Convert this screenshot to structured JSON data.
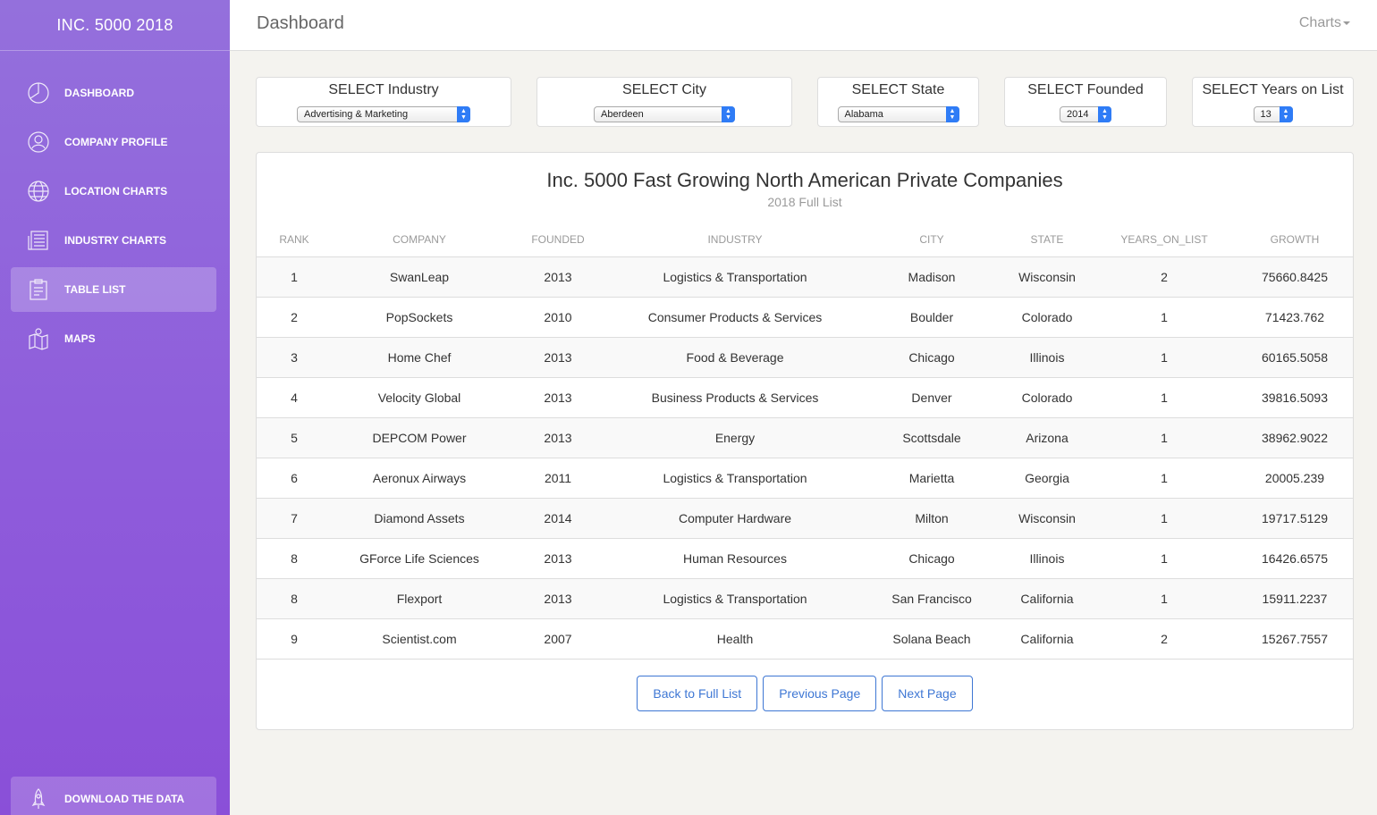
{
  "app": {
    "brand": "INC. 5000 2018"
  },
  "header": {
    "title": "Dashboard",
    "menu": "Charts"
  },
  "sidebar": {
    "items": [
      {
        "label": "DASHBOARD",
        "icon": "pie-chart-icon",
        "active": false
      },
      {
        "label": "COMPANY PROFILE",
        "icon": "user-icon",
        "active": false
      },
      {
        "label": "LOCATION CHARTS",
        "icon": "globe-icon",
        "active": false
      },
      {
        "label": "INDUSTRY CHARTS",
        "icon": "news-icon",
        "active": false
      },
      {
        "label": "TABLE LIST",
        "icon": "clipboard-icon",
        "active": true
      },
      {
        "label": "MAPS",
        "icon": "map-icon",
        "active": false
      }
    ],
    "download": {
      "label": "DOWNLOAD THE DATA",
      "icon": "rocket-icon"
    }
  },
  "filters": [
    {
      "label": "SELECT Industry",
      "value": "Advertising & Marketing"
    },
    {
      "label": "SELECT City",
      "value": "Aberdeen"
    },
    {
      "label": "SELECT State",
      "value": "Alabama"
    },
    {
      "label": "SELECT Founded",
      "value": "2014"
    },
    {
      "label": "SELECT Years on List",
      "value": "13"
    }
  ],
  "table": {
    "title": "Inc. 5000 Fast Growing North American Private Companies",
    "subtitle": "2018 Full List",
    "columns": [
      "RANK",
      "COMPANY",
      "FOUNDED",
      "INDUSTRY",
      "CITY",
      "STATE",
      "YEARS_ON_LIST",
      "GROWTH"
    ],
    "rows": [
      [
        "1",
        "SwanLeap",
        "2013",
        "Logistics & Transportation",
        "Madison",
        "Wisconsin",
        "2",
        "75660.8425"
      ],
      [
        "2",
        "PopSockets",
        "2010",
        "Consumer Products & Services",
        "Boulder",
        "Colorado",
        "1",
        "71423.762"
      ],
      [
        "3",
        "Home Chef",
        "2013",
        "Food & Beverage",
        "Chicago",
        "Illinois",
        "1",
        "60165.5058"
      ],
      [
        "4",
        "Velocity Global",
        "2013",
        "Business Products & Services",
        "Denver",
        "Colorado",
        "1",
        "39816.5093"
      ],
      [
        "5",
        "DEPCOM Power",
        "2013",
        "Energy",
        "Scottsdale",
        "Arizona",
        "1",
        "38962.9022"
      ],
      [
        "6",
        "Aeronux Airways",
        "2011",
        "Logistics & Transportation",
        "Marietta",
        "Georgia",
        "1",
        "20005.239"
      ],
      [
        "7",
        "Diamond Assets",
        "2014",
        "Computer Hardware",
        "Milton",
        "Wisconsin",
        "1",
        "19717.5129"
      ],
      [
        "8",
        "GForce Life Sciences",
        "2013",
        "Human Resources",
        "Chicago",
        "Illinois",
        "1",
        "16426.6575"
      ],
      [
        "8",
        "Flexport",
        "2013",
        "Logistics & Transportation",
        "San Francisco",
        "California",
        "1",
        "15911.2237"
      ],
      [
        "9",
        "Scientist.com",
        "2007",
        "Health",
        "Solana Beach",
        "California",
        "2",
        "15267.7557"
      ]
    ]
  },
  "pager": {
    "back": "Back to Full List",
    "prev": "Previous Page",
    "next": "Next Page"
  },
  "colors": {
    "sidebar": "#8e5bdb",
    "button": "#3e77d4",
    "select_arrow": "#2f7cf6"
  }
}
